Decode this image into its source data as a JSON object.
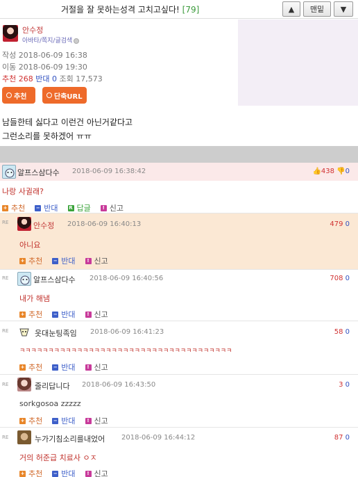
{
  "topbar": {
    "title": "거절을 잘 못하는성격 고치고싶다!",
    "count": "[79]",
    "up_icon": "triangle-up-icon",
    "top_label": "맨밑",
    "down_icon": "triangle-down-icon"
  },
  "post": {
    "author": "안수정",
    "author_links": "아바타/쪽지/글검색",
    "written": "작성 2018-06-09 16:38",
    "moved": "이동 2018-06-09 19:30",
    "rec_label": "추천",
    "rec_count": "268",
    "opp_label": "반대",
    "opp_count": "0",
    "views_label": "조회",
    "views": "17,573",
    "btn_recommend": "추천",
    "btn_shorturl": "단축URL",
    "body_line1": "남들한테 싫다고 이런건 아닌거같다고",
    "body_line2": "그런소리를 못하겠어 ㅠㅠ"
  },
  "actions": {
    "rec": "추천",
    "opp": "반대",
    "reply": "답글",
    "report": "신고"
  },
  "comments": [
    {
      "nick": "알프스삼다수",
      "date": "2018-06-09 16:38:42",
      "up": "438",
      "down": "0",
      "text": "나랑 사귈래?"
    },
    {
      "nick": "안수정",
      "date": "2018-06-09 16:40:13",
      "up": "479",
      "down": "0",
      "text": "아니요"
    },
    {
      "nick": "알프스삼다수",
      "date": "2018-06-09 16:40:56",
      "up": "708",
      "down": "0",
      "text": "내가 해냄"
    },
    {
      "nick": "옷대눈팅족임",
      "date": "2018-06-09 16:41:23",
      "up": "58",
      "down": "0",
      "text": "ㅋㅋㅋㅋㅋㅋㅋㅋㅋㅋㅋㅋㅋㅋㅋㅋㅋㅋㅋㅋㅋㅋㅋㅋㅋㅋㅋㅋㅋㅋㅋㅋㅋㅋㅋㅋㅋ"
    },
    {
      "nick": "줄리답니다",
      "date": "2018-06-09 16:43:50",
      "up": "3",
      "down": "0",
      "text": "sorkgosoa zzzzz"
    },
    {
      "nick": "누가기침소리를내었어",
      "date": "2018-06-09 16:44:12",
      "up": "87",
      "down": "0",
      "text": "거의 허준급 치료사 ㅇㅈ"
    }
  ],
  "re_label": "RE",
  "colors": {
    "accent_orange": "#ee6a2a",
    "recommend_red": "#d03030",
    "oppose_blue": "#3050c0",
    "highlight_pink": "#fbe9e9",
    "highlight_peach": "#fbe8d4"
  }
}
